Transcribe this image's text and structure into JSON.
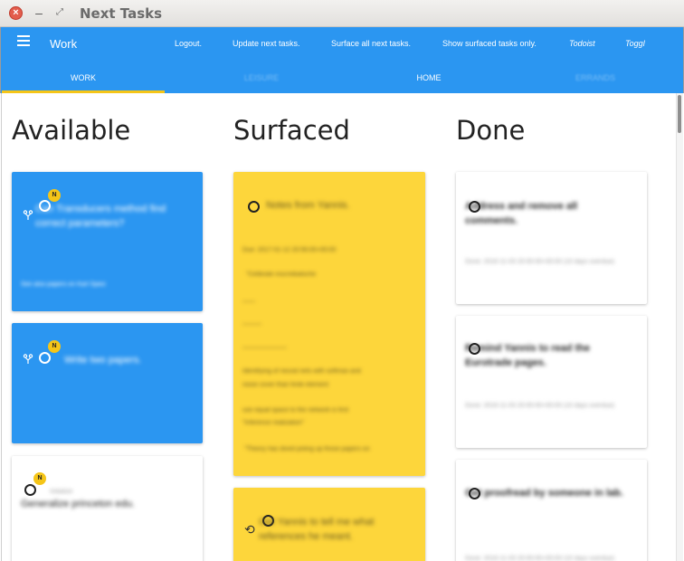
{
  "window": {
    "title": "Next Tasks",
    "close_glyph": "×",
    "min_glyph": "–",
    "max_glyph": "⤢"
  },
  "appbar": {
    "title": "Work",
    "color": "#2b96f1",
    "links": [
      "Logout.",
      "Update next tasks.",
      "Surface all next tasks.",
      "Show surfaced tasks only.",
      "Todoist",
      "Toggl"
    ]
  },
  "tabs": [
    "WORK",
    "LEISURE",
    "HOME",
    "ERRANDS"
  ],
  "columns": {
    "available": "Available",
    "surfaced": "Surfaced",
    "done": "Done"
  },
  "available_cards": [
    {
      "badge": "N",
      "title": "Can Transducers method find correct parameters?",
      "foot": "See also papers on Karl Spiez"
    },
    {
      "badge": "N",
      "title": "Write two papers."
    },
    {
      "badge": "N",
      "tag": "Initialize",
      "title": "Generalize princeton edu."
    }
  ],
  "surfaced_cards": [
    {
      "title": "Notes from Yannis.",
      "lines": [
        "Due: 2017-01-12 20:56:00+00:00",
        "\"Celibrate inscreibatsche",
        "——",
        "———",
        "———————",
        "Identifying of neural nets with softmax and",
        "noise cover than finite element",
        "use equal space to the network is first",
        "\"Inference realization\"",
        "\"Theory has dived poling up those papers on"
      ]
    },
    {
      "title": "Get Yannis to tell me what references he meant."
    }
  ],
  "done_cards": [
    {
      "title": "Address and remove all comments.",
      "meta": "Done: 2016-11-03 20:00:00+00:00 (10 days overdue)"
    },
    {
      "title": "Remind Yannis to read the Eurotrade pages.",
      "meta": "Done: 2016-11-03 20:00:00+00:00 (10 days overdue)"
    },
    {
      "title": "Get proofread by someone in lab.",
      "meta": "Done: 2016-11-03 20:00:00+00:00 (10 days overdue)"
    }
  ]
}
